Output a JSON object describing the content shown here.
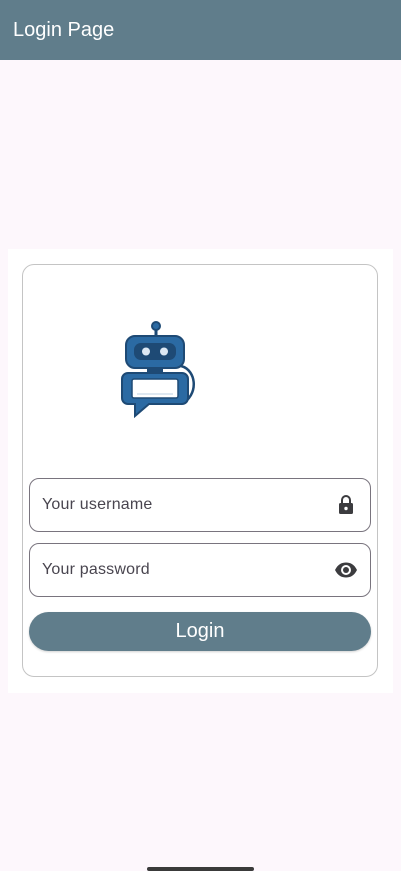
{
  "app_bar": {
    "title": "Login Page",
    "color": "#607d8b"
  },
  "logo": {
    "icon": "robot-chat-icon"
  },
  "username": {
    "placeholder": "Your username",
    "icon": "lock-icon"
  },
  "password": {
    "placeholder": "Your password",
    "icon": "visibility-icon"
  },
  "login_button": {
    "label": "Login"
  },
  "colors": {
    "background": "#fdf7fc",
    "primary": "#607d8b",
    "robot_blue": "#2b5f8f"
  }
}
